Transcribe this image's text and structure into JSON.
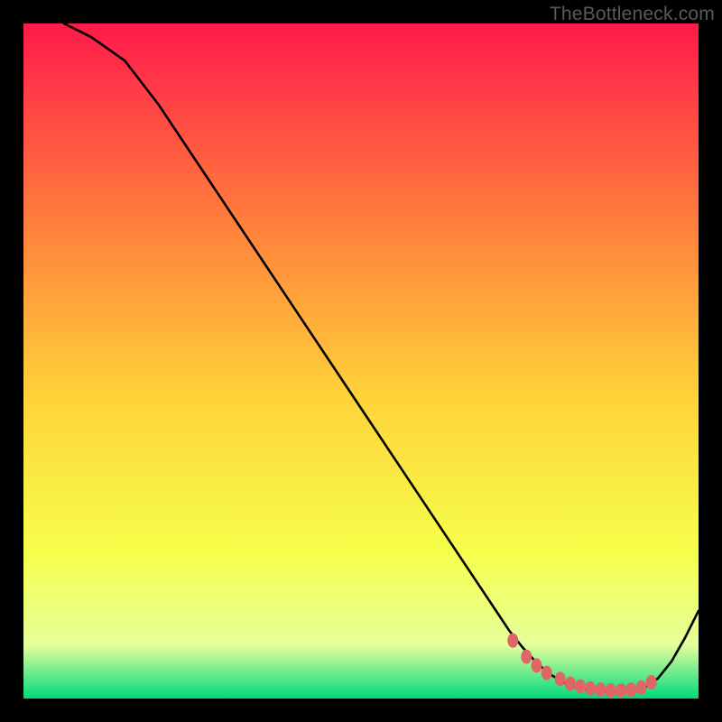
{
  "watermark": "TheBottleneck.com",
  "chart_data": {
    "type": "line",
    "title": "",
    "xlabel": "",
    "ylabel": "",
    "xlim": [
      0,
      100
    ],
    "ylim": [
      0,
      100
    ],
    "grid": false,
    "background_gradient": {
      "top_color": "#ff1a4b",
      "mid_upper_color": "#ff7a3c",
      "mid_color": "#ffd23a",
      "mid_lower_color": "#f6ff4a",
      "low_color": "#e6ff9a",
      "bottom_color": "#00d980"
    },
    "series": [
      {
        "name": "bottleneck-curve",
        "color": "#000000",
        "x": [
          6,
          10,
          15,
          20,
          25,
          30,
          35,
          40,
          45,
          50,
          55,
          60,
          65,
          70,
          72,
          74,
          76,
          78,
          80,
          82,
          84,
          86,
          88,
          90,
          92,
          94,
          96,
          98,
          100
        ],
        "y": [
          100,
          98,
          94.5,
          88,
          80.5,
          73,
          65.5,
          58,
          50.5,
          43,
          35.5,
          28,
          20.5,
          13,
          10,
          7.5,
          5.3,
          3.6,
          2.4,
          1.6,
          1.2,
          1.0,
          1.0,
          1.1,
          1.6,
          3.0,
          5.5,
          9.0,
          13
        ]
      }
    ],
    "markers": {
      "name": "optimal-range-dots",
      "color": "#e06666",
      "x": [
        72.5,
        74.5,
        76,
        77.5,
        79.5,
        81,
        82.5,
        84,
        85.5,
        87,
        88.5,
        90,
        91.5,
        93
      ],
      "y": [
        8.6,
        6.2,
        4.9,
        3.8,
        2.9,
        2.2,
        1.8,
        1.5,
        1.3,
        1.2,
        1.2,
        1.3,
        1.6,
        2.4
      ]
    }
  }
}
